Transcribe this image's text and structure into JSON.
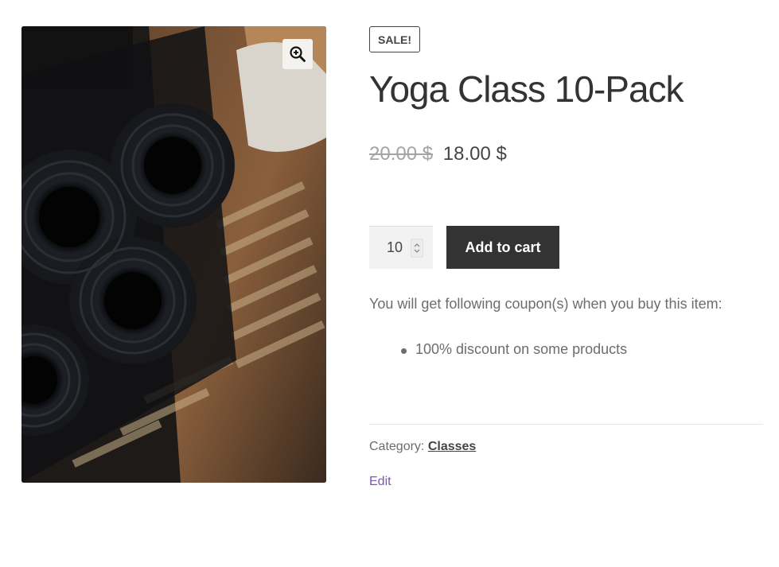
{
  "product": {
    "badge": "SALE!",
    "title": "Yoga Class 10-Pack",
    "price_old": "20.00 $",
    "price_new": "18.00 $"
  },
  "cart": {
    "quantity": "10",
    "add_label": "Add to cart"
  },
  "coupon": {
    "intro": "You will get following coupon(s) when you buy this item:",
    "items": [
      "100% discount on some products"
    ]
  },
  "meta": {
    "category_label": "Category:",
    "category_value": "Classes",
    "edit_label": "Edit"
  },
  "icons": {
    "zoom": "zoom-in-icon",
    "stepper": "chevron-up-down-icon"
  },
  "colors": {
    "button_bg": "#333333",
    "edit_link": "#7f54b3",
    "old_price": "#a4a4a4"
  }
}
